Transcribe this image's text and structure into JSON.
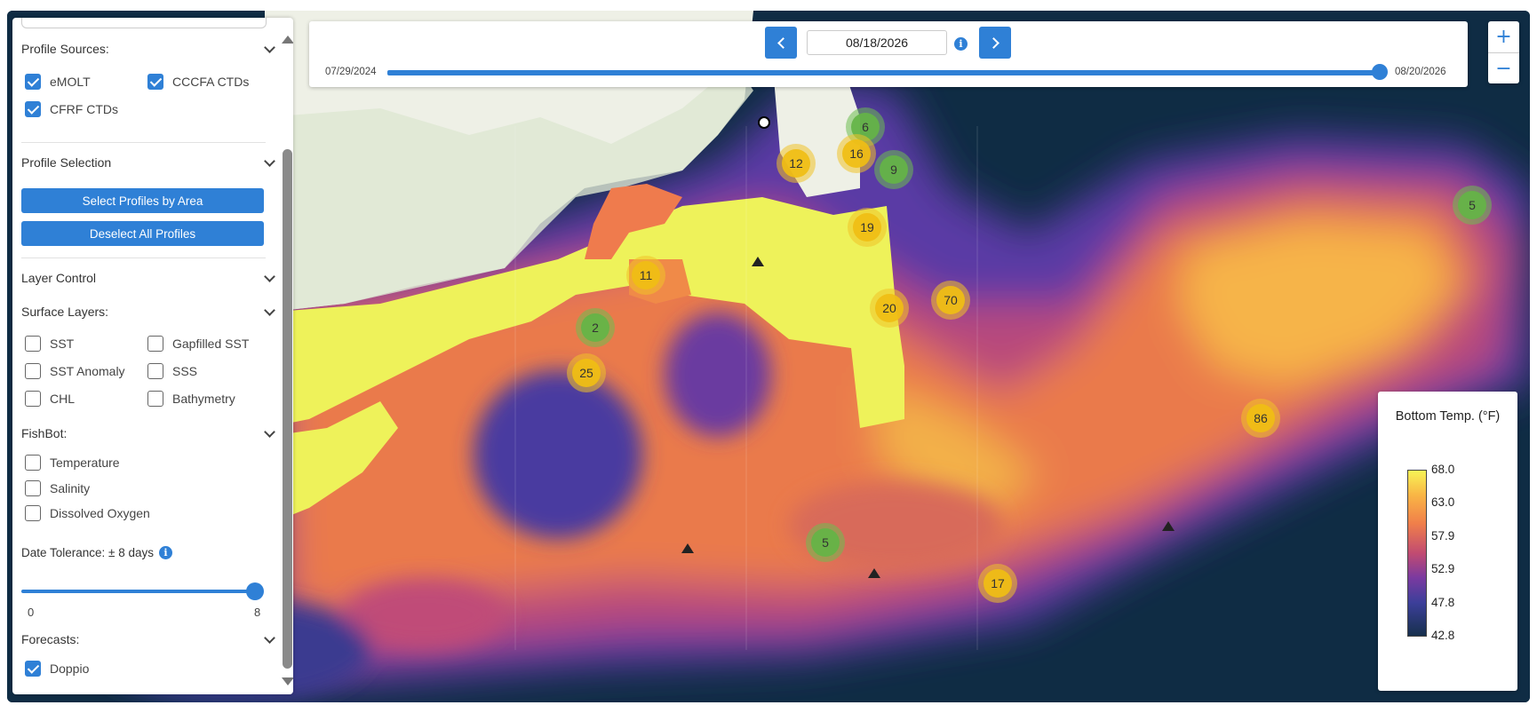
{
  "timeline": {
    "current_date": "08/18/2026",
    "start_label": "07/29/2024",
    "end_label": "08/20/2026",
    "position": 0.9975
  },
  "zoom": {
    "in": "+",
    "out": "−"
  },
  "panel": {
    "profile_sources": {
      "title": "Profile Sources:",
      "options": [
        {
          "label": "eMOLT",
          "checked": true
        },
        {
          "label": "CCCFA CTDs",
          "checked": true
        },
        {
          "label": "CFRF CTDs",
          "checked": true
        }
      ]
    },
    "profile_selection": {
      "title": "Profile Selection",
      "select_button": "Select Profiles by Area",
      "deselect_button": "Deselect All Profiles"
    },
    "layer_control": {
      "title": "Layer Control"
    },
    "surface_layers": {
      "title": "Surface Layers:",
      "options": [
        {
          "label": "SST",
          "checked": false
        },
        {
          "label": "Gapfilled SST",
          "checked": false
        },
        {
          "label": "SST Anomaly",
          "checked": false
        },
        {
          "label": "SSS",
          "checked": false
        },
        {
          "label": "CHL",
          "checked": false
        },
        {
          "label": "Bathymetry",
          "checked": false
        }
      ]
    },
    "fishbot": {
      "title": "FishBot:",
      "options": [
        {
          "label": "Temperature",
          "checked": false
        },
        {
          "label": "Salinity",
          "checked": false
        },
        {
          "label": "Dissolved Oxygen",
          "checked": false
        }
      ]
    },
    "date_tolerance": {
      "label": "Date Tolerance: ± 8 days",
      "min": "0",
      "max": "8",
      "value": 8
    },
    "forecasts": {
      "title": "Forecasts:",
      "options": [
        {
          "label": "Doppio",
          "checked": true
        }
      ]
    }
  },
  "legend": {
    "title": "Bottom Temp. (°F)",
    "ticks": [
      "68.0",
      "63.0",
      "57.9",
      "52.9",
      "47.8",
      "42.8"
    ]
  },
  "clusters": [
    {
      "count": "6",
      "color": "green"
    },
    {
      "count": "16",
      "color": "yellow"
    },
    {
      "count": "12",
      "color": "yellow"
    },
    {
      "count": "9",
      "color": "green"
    },
    {
      "count": "19",
      "color": "yellow"
    },
    {
      "count": "11",
      "color": "yellow"
    },
    {
      "count": "20",
      "color": "yellow"
    },
    {
      "count": "70",
      "color": "yellow"
    },
    {
      "count": "2",
      "color": "green"
    },
    {
      "count": "25",
      "color": "yellow"
    },
    {
      "count": "5",
      "color": "green"
    },
    {
      "count": "86",
      "color": "yellow"
    },
    {
      "count": "5",
      "color": "green"
    },
    {
      "count": "17",
      "color": "yellow"
    }
  ]
}
